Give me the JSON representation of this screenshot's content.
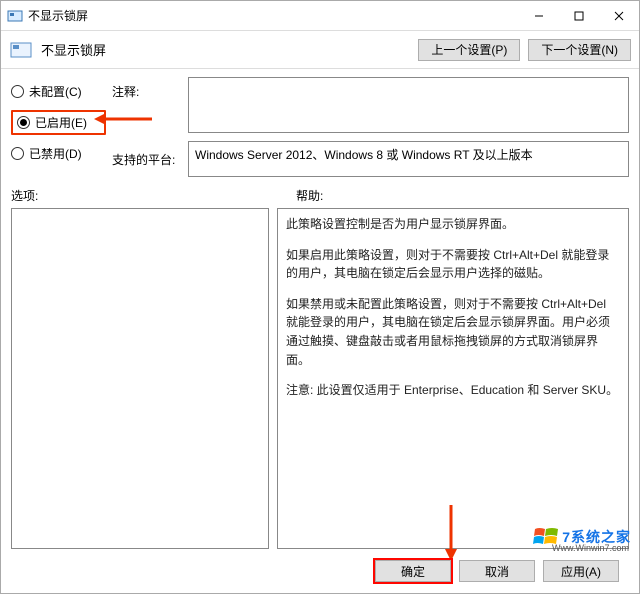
{
  "window": {
    "title": "不显示锁屏"
  },
  "header": {
    "title": "不显示锁屏",
    "prev_btn": "上一个设置(P)",
    "next_btn": "下一个设置(N)"
  },
  "radios": {
    "unconfigured": "未配置(C)",
    "enabled": "已启用(E)",
    "disabled": "已禁用(D)",
    "selected": "enabled"
  },
  "labels": {
    "comment": "注释:",
    "platform": "支持的平台:",
    "options": "选项:",
    "help": "帮助:"
  },
  "fields": {
    "comment_value": "",
    "platform_value": "Windows Server 2012、Windows 8 或 Windows RT 及以上版本"
  },
  "help": {
    "p1": "此策略设置控制是否为用户显示锁屏界面。",
    "p2": "如果启用此策略设置，则对于不需要按 Ctrl+Alt+Del 就能登录的用户，其电脑在锁定后会显示用户选择的磁贴。",
    "p3": "如果禁用或未配置此策略设置，则对于不需要按 Ctrl+Alt+Del 就能登录的用户，其电脑在锁定后会显示锁屏界面。用户必须通过触摸、键盘敲击或者用鼠标拖拽锁屏的方式取消锁屏界面。",
    "p4": "注意: 此设置仅适用于 Enterprise、Education 和 Server SKU。"
  },
  "footer": {
    "ok": "确定",
    "cancel": "取消",
    "apply": "应用(A)"
  },
  "watermark": {
    "text": "7系统之家",
    "sub": "Www.Winwin7.com"
  }
}
